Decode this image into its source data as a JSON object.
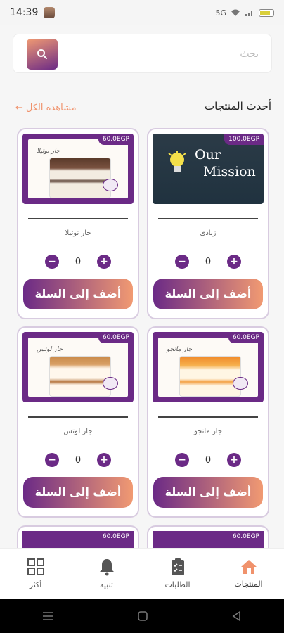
{
  "status_bar": {
    "time": "14:39",
    "network": "5G"
  },
  "search": {
    "placeholder": "بحث",
    "icon": "search-icon"
  },
  "section": {
    "title": "أحدث المنتجات",
    "see_all": "مشاهدة الكل"
  },
  "products": [
    {
      "price": "100.0EGP",
      "name": "زبادى",
      "quantity": "0",
      "add_label": "أضف إلى السلة",
      "image_text": [
        "Our",
        "Mission"
      ]
    },
    {
      "price": "60.0EGP",
      "name": "جار نوتيلا",
      "quantity": "0",
      "add_label": "أضف إلى السلة",
      "image_label": "جار نوتيلا"
    },
    {
      "price": "60.0EGP",
      "name": "جار مانجو",
      "quantity": "0",
      "add_label": "أضف إلى السلة",
      "image_label": "جار مانجو"
    },
    {
      "price": "60.0EGP",
      "name": "جار لوتس",
      "quantity": "0",
      "add_label": "أضف إلى السلة",
      "image_label": "جار لوتس"
    },
    {
      "price": "60.0EGP"
    },
    {
      "price": "60.0EGP"
    }
  ],
  "bottom_nav": [
    {
      "label": "المنتجات",
      "icon": "home-icon",
      "active": true
    },
    {
      "label": "الطلبات",
      "icon": "clipboard-icon"
    },
    {
      "label": "تنبيه",
      "icon": "bell-icon"
    },
    {
      "label": "أكثر",
      "icon": "grid-icon"
    }
  ],
  "colors": {
    "brand_purple": "#6b2a86",
    "brand_orange": "#f19a72",
    "active_nav": "#f0926c"
  }
}
